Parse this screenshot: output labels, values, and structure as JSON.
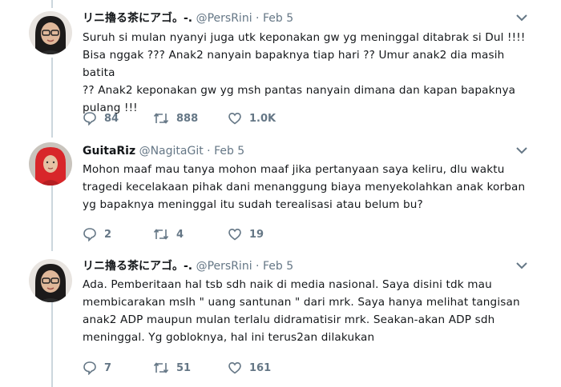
{
  "tweets": [
    {
      "display_name": "リニ擼る茶にアゴ。-.",
      "handle": "@PersRini",
      "separator": "·",
      "time": "Feb 5",
      "text_lines": [
        "Suruh si mulan nyanyi juga utk keponakan gw yg meninggal ditabrak si Dul !!!!",
        "Bisa nggak ??? Anak2 nanyain bapaknya tiap hari ?? Umur anak2 dia masih batita",
        "?? Anak2 keponakan gw yg msh pantas nanyain dimana dan kapan bapaknya",
        "pulang !!!"
      ],
      "replies": "84",
      "retweets": "888",
      "likes": "1.0K",
      "avatar": "woman-glasses-avatar"
    },
    {
      "display_name": "GuitaRiz",
      "handle": "@NagitaGit",
      "separator": "·",
      "time": "Feb 5",
      "text_lines": [
        "Mohon maaf mau tanya mohon maaf jika pertanyaan saya keliru, dlu waktu",
        "tragedi kecelakaan pihak dani menanggung biaya menyekolahkan anak korban",
        "yg bapaknya meninggal itu sudah terealisasi atau belum bu?"
      ],
      "replies": "2",
      "retweets": "4",
      "likes": "19",
      "avatar": "red-hijab-avatar"
    },
    {
      "display_name": "リニ擼る茶にアゴ。-.",
      "handle": "@PersRini",
      "separator": "·",
      "time": "Feb 5",
      "text_lines": [
        "Ada. Pemberitaan hal tsb sdh naik di media nasional. Saya disini tdk mau",
        "membicarakan mslh \" uang santunan \" dari mrk. Saya hanya melihat tangisan",
        "anak2 ADP maupun mulan terlalu didramatisir mrk. Seakan-akan ADP sdh",
        "meninggal. Yg gobloknya, hal ini terus2an dilakukan"
      ],
      "replies": "7",
      "retweets": "51",
      "likes": "161",
      "avatar": "woman-glasses-avatar"
    }
  ],
  "colors": {
    "text": "#14171a",
    "secondary": "#657786",
    "thread_line": "#ccd6dd"
  },
  "icons": {
    "reply": "reply-icon",
    "retweet": "retweet-icon",
    "like": "heart-icon",
    "menu": "chevron-down-icon"
  }
}
